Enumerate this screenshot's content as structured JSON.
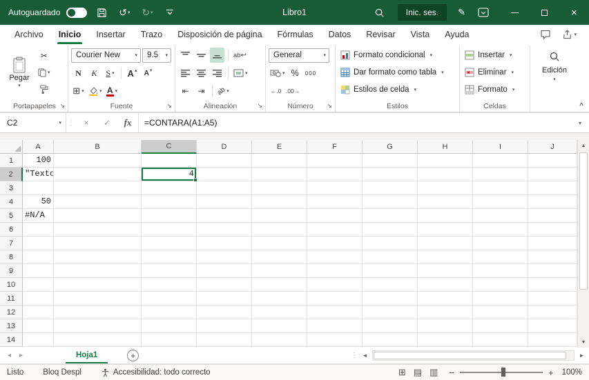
{
  "colors": {
    "title_green": "#185C37",
    "accent_green": "#107C41",
    "signin_green": "#0E4326",
    "font_color_red": "#C00000"
  },
  "title_bar": {
    "autosave_label": "Autoguardado",
    "workbook_title": "Libro1",
    "signin_label": "Inic. ses."
  },
  "tabs": [
    {
      "label": "Archivo",
      "active": false
    },
    {
      "label": "Inicio",
      "active": true
    },
    {
      "label": "Insertar",
      "active": false
    },
    {
      "label": "Trazo",
      "active": false
    },
    {
      "label": "Disposición de página",
      "active": false
    },
    {
      "label": "Fórmulas",
      "active": false
    },
    {
      "label": "Datos",
      "active": false
    },
    {
      "label": "Revisar",
      "active": false
    },
    {
      "label": "Vista",
      "active": false
    },
    {
      "label": "Ayuda",
      "active": false
    }
  ],
  "ribbon": {
    "paste_label": "Pegar",
    "font_name": "Courier New",
    "font_size": "9.5",
    "bold": "N",
    "italic": "K",
    "underline": "S",
    "number_format": "General",
    "styles_buttons": [
      "Formato condicional",
      "Dar formato como tabla",
      "Estilos de celda"
    ],
    "cells_buttons": [
      "Insertar",
      "Eliminar",
      "Formato"
    ],
    "edit_label": "Edición",
    "group_labels": [
      "Portapapeles",
      "Fuente",
      "Alineación",
      "Número",
      "Estilos",
      "Celdas"
    ]
  },
  "formula_bar": {
    "name_box": "C2",
    "fx_label": "fx",
    "formula": "=CONTARA(A1:A5)"
  },
  "grid": {
    "columns": [
      "A",
      "B",
      "C",
      "D",
      "E",
      "F",
      "G",
      "H",
      "I",
      "J"
    ],
    "row_count": 14,
    "selected_column": "C",
    "selected_row": 2,
    "selection": "C2",
    "cells": {
      "A1": {
        "value": "100",
        "align": "right"
      },
      "A2": {
        "value": "\"Texto\"",
        "align": "left"
      },
      "A4": {
        "value": "50",
        "align": "right"
      },
      "A5": {
        "value": "#N/A",
        "align": "left"
      },
      "C2": {
        "value": "4",
        "align": "right",
        "selected": true
      }
    }
  },
  "sheet_bar": {
    "tabs": [
      {
        "label": "Hoja1",
        "active": true
      }
    ]
  },
  "status_bar": {
    "mode": "Listo",
    "scroll_lock": "Bloq Despl",
    "accessibility": "Accesibilidad: todo correcto",
    "zoom": "100%"
  },
  "icons": {
    "chevron_down": "▾",
    "collapse_ribbon": "^",
    "undo": "↺",
    "redo": "↻",
    "scissors": "✂",
    "launcher": "↘",
    "cancel": "×",
    "accept": "✓",
    "arrow_up": "▲",
    "arrow_down": "▼",
    "arrow_left": "◄",
    "arrow_right": "►",
    "sheet_prev": "◂",
    "sheet_next": "▸",
    "zoom_out": "−",
    "zoom_in": "+",
    "percent": "%",
    "comma": "000",
    "increase_decimal": "←.0",
    "decrease_decimal": ".00→",
    "borders": "⊞",
    "letter_a": "A",
    "tri_up": "▴",
    "tri_down": "▾",
    "wrap": "ab",
    "wrap_arrow": "↩",
    "orientation": "ab",
    "outdent": "⇤",
    "indent": "⇥",
    "dots": "⋮",
    "plus": "+",
    "pen": "✎",
    "view_normal": "⊞",
    "view_layout": "▤",
    "view_break": "▥"
  }
}
